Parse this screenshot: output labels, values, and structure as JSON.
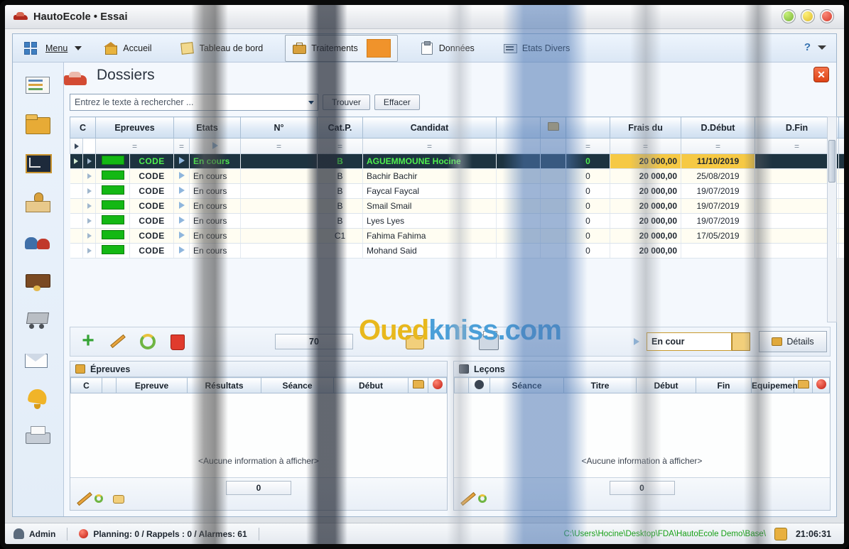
{
  "window": {
    "title": "HautoEcole • Essai",
    "controls": [
      "minimize",
      "maximize",
      "close"
    ]
  },
  "ribbon": {
    "menu_label": "Menu",
    "items": [
      {
        "label": "Accueil",
        "icon": "home-icon"
      },
      {
        "label": "Tableau de bord",
        "icon": "clipboard-icon"
      },
      {
        "label": "Traitements",
        "icon": "briefcase-icon",
        "selected": true
      },
      {
        "label": "Données",
        "icon": "note-icon"
      },
      {
        "label": "Etats Divers",
        "icon": "report-icon"
      }
    ],
    "help": "?"
  },
  "sidebar": {
    "items": [
      {
        "name": "inscriptions-icon"
      },
      {
        "name": "dossiers-icon"
      },
      {
        "name": "cours-icon"
      },
      {
        "name": "moniteurs-icon"
      },
      {
        "name": "candidats-icon"
      },
      {
        "name": "caisse-icon"
      },
      {
        "name": "achats-icon"
      },
      {
        "name": "courrier-icon"
      },
      {
        "name": "alarmes-icon"
      },
      {
        "name": "impression-icon"
      }
    ]
  },
  "page": {
    "title": "Dossiers",
    "close_label": "✕"
  },
  "search": {
    "placeholder": "Entrez le texte à rechercher ...",
    "value": "",
    "find_label": "Trouver",
    "clear_label": "Effacer"
  },
  "grid": {
    "columns": [
      "C",
      "Epreuves",
      "Etats",
      "N°",
      "Cat.P.",
      "Candidat",
      "",
      "",
      "Frais du",
      "D.Début",
      "D.Fin",
      ""
    ],
    "filter_symbol": "=",
    "rows": [
      {
        "code": "CODE",
        "etat": "En cours",
        "num": "",
        "cat": "B",
        "candidat": "AGUEMMOUNE Hocine",
        "zero": "0",
        "frais": "20 000,00",
        "debut": "11/10/2019",
        "fin": "",
        "flag": "alert",
        "selected": true
      },
      {
        "code": "CODE",
        "etat": "En cours",
        "num": "",
        "cat": "B",
        "candidat": "Bachir Bachir",
        "zero": "0",
        "frais": "20 000,00",
        "debut": "25/08/2019",
        "fin": "",
        "flag": "alert",
        "selected": false
      },
      {
        "code": "CODE",
        "etat": "En cours",
        "num": "",
        "cat": "B",
        "candidat": "Faycal Faycal",
        "zero": "0",
        "frais": "20 000,00",
        "debut": "19/07/2019",
        "fin": "",
        "flag": "alert",
        "selected": false
      },
      {
        "code": "CODE",
        "etat": "En cours",
        "num": "",
        "cat": "B",
        "candidat": "Smail Smail",
        "zero": "0",
        "frais": "20 000,00",
        "debut": "19/07/2019",
        "fin": "",
        "flag": "alert",
        "selected": false
      },
      {
        "code": "CODE",
        "etat": "En cours",
        "num": "",
        "cat": "B",
        "candidat": "Lyes Lyes",
        "zero": "0",
        "frais": "20 000,00",
        "debut": "19/07/2019",
        "fin": "",
        "flag": "print",
        "selected": false
      },
      {
        "code": "CODE",
        "etat": "En cours",
        "num": "",
        "cat": "C1",
        "candidat": "Fahima Fahima",
        "zero": "0",
        "frais": "20 000,00",
        "debut": "17/05/2019",
        "fin": "",
        "flag": "print",
        "selected": false
      },
      {
        "code": "CODE",
        "etat": "En cours",
        "num": "",
        "cat": "",
        "candidat": "Mohand Said",
        "zero": "0",
        "frais": "20 000,00",
        "debut": "",
        "fin": "",
        "flag": "print",
        "selected": false
      }
    ]
  },
  "actionbar": {
    "buttons": [
      "add-icon",
      "edit-icon",
      "refresh-icon",
      "delete-icon",
      "memo-icon",
      "print-icon"
    ],
    "count": "70",
    "state_value": "En cour",
    "details_label": "Détails"
  },
  "watermark": {
    "part1": "Oued",
    "part2": "kniss.com"
  },
  "epreuves_panel": {
    "title": "Épreuves",
    "columns": [
      "C",
      "Epreuve",
      "Résultats",
      "Séance",
      "Début"
    ],
    "empty_text": "<Aucune information à afficher>",
    "count": "0"
  },
  "lecons_panel": {
    "title": "Leçons",
    "columns": [
      "",
      "Séance",
      "Titre",
      "Début",
      "Fin",
      "Equipement"
    ],
    "empty_text": "<Aucune information à afficher>",
    "count": "0"
  },
  "statusbar": {
    "user": "Admin",
    "alarms": "Planning: 0 / Rappels : 0 / Alarmes: 61",
    "path": "C:\\Users\\Hocine\\Desktop\\FDA\\HautoEcole Demo\\Base\\",
    "time": "21:06:31"
  },
  "colors": {
    "accent": "#3f7fc1",
    "selected_row_bg": "#1d3340",
    "selected_row_text": "#4ef04e",
    "highlight_cell": "#f6c944",
    "status_green": "#14b814",
    "watermark_yellow": "#e8b81d",
    "watermark_blue": "#4a9fd8"
  }
}
